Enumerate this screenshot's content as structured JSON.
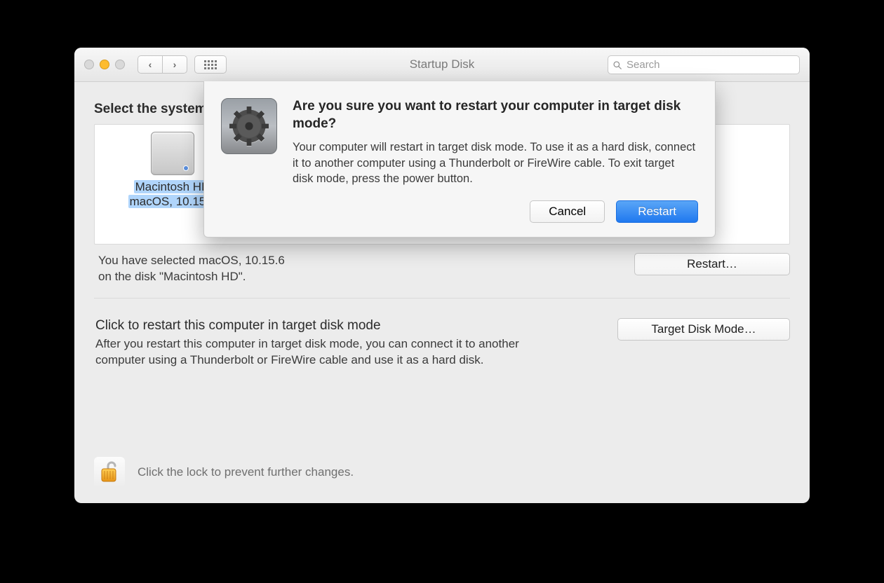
{
  "window": {
    "title": "Startup Disk",
    "search_placeholder": "Search"
  },
  "main": {
    "heading": "Select the system you want to use to start up your computer",
    "disk": {
      "name": "Macintosh HD",
      "subtitle": "macOS, 10.15.6"
    },
    "selection_info": "You have selected macOS, 10.15.6\non the disk \"Macintosh HD\".",
    "restart_button": "Restart…"
  },
  "target_disk": {
    "title": "Click to restart this computer in target disk mode",
    "body": "After you restart this computer in target disk mode, you can connect it to another computer using a Thunderbolt or FireWire cable and use it as a hard disk.",
    "button": "Target Disk Mode…"
  },
  "lock": {
    "text": "Click the lock to prevent further changes."
  },
  "sheet": {
    "title": "Are you sure you want to restart your computer in target disk mode?",
    "desc": "Your computer will restart in target disk mode. To use it as a hard disk, connect it to another computer using a Thunderbolt or FireWire cable. To exit target disk mode, press the power button.",
    "cancel": "Cancel",
    "confirm": "Restart"
  }
}
